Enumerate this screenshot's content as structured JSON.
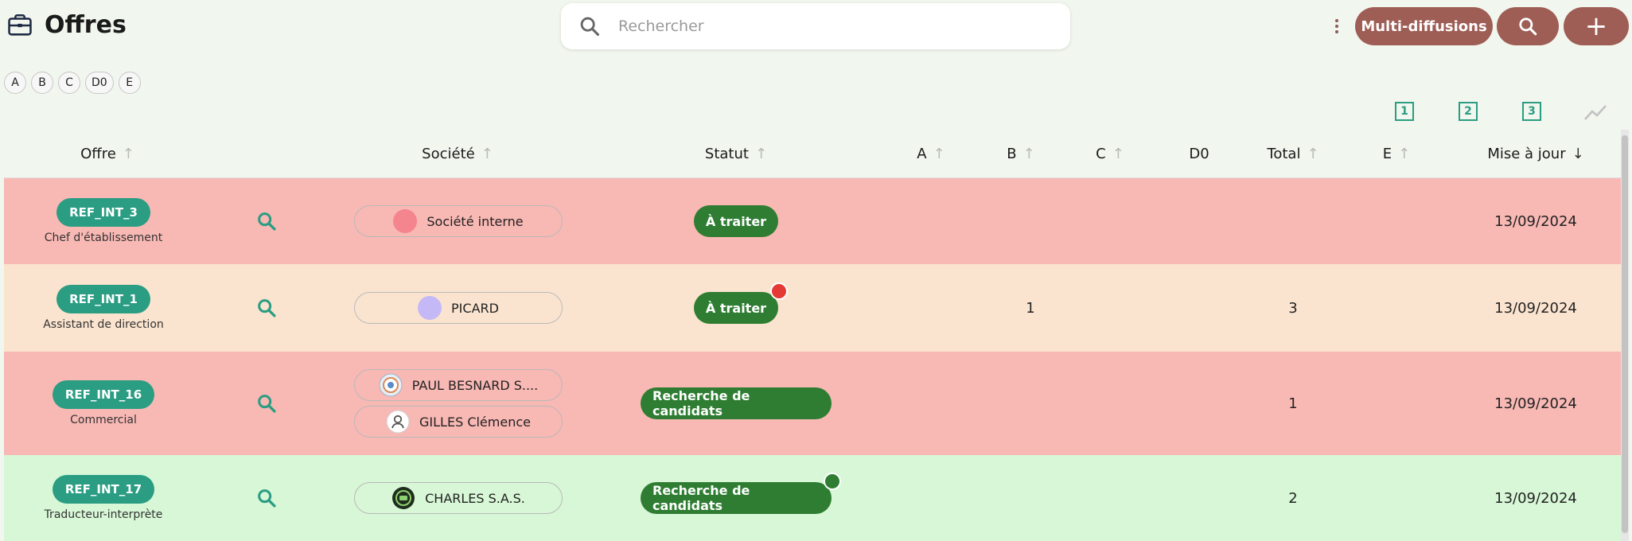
{
  "header": {
    "title": "Offres",
    "search_placeholder": "Rechercher",
    "multi_label": "Multi-diffusions",
    "add_glyph": "+"
  },
  "filters": [
    "A",
    "B",
    "C",
    "D0",
    "E"
  ],
  "metric_icons": [
    "1",
    "2",
    "3"
  ],
  "columns": {
    "offre": "Offre",
    "societe": "Société",
    "statut": "Statut",
    "a": "A",
    "b": "B",
    "c": "C",
    "d0": "D0",
    "total": "Total",
    "e": "E",
    "maj": "Mise à jour"
  },
  "rows": [
    {
      "ref": "REF_INT_3",
      "poste": "Chef d'établissement",
      "companies": [
        {
          "name": "Société interne",
          "avatar": "pink-circle"
        }
      ],
      "statut": "À traiter",
      "statut_dot": "",
      "b": "",
      "total": "",
      "date": "13/09/2024",
      "row_color": "#f8b8b4"
    },
    {
      "ref": "REF_INT_1",
      "poste": "Assistant de direction",
      "companies": [
        {
          "name": "PICARD",
          "avatar": "lavender-circle"
        }
      ],
      "statut": "À traiter",
      "statut_dot": "#e53935",
      "b": "1",
      "total": "3",
      "date": "13/09/2024",
      "row_color": "#fbe4cf"
    },
    {
      "ref": "REF_INT_16",
      "poste": "Commercial",
      "companies": [
        {
          "name": "PAUL BESNARD S....",
          "avatar": "logo-badge"
        },
        {
          "name": "GILLES Clémence",
          "avatar": "person-icon"
        }
      ],
      "statut": "Recherche de candidats",
      "statut_dot": "",
      "b": "",
      "total": "1",
      "date": "13/09/2024",
      "row_color": "#f8b8b4"
    },
    {
      "ref": "REF_INT_17",
      "poste": "Traducteur-interprète",
      "companies": [
        {
          "name": "CHARLES S.A.S.",
          "avatar": "green-logo"
        }
      ],
      "statut": "Recherche de candidats",
      "statut_dot": "#2e7d32",
      "b": "",
      "total": "2",
      "date": "13/09/2024",
      "row_color": "#d7f7d6"
    }
  ],
  "colors": {
    "accent_teal": "#2a9d83",
    "brand_brown": "#9e5d55",
    "status_green": "#2e7d32"
  }
}
